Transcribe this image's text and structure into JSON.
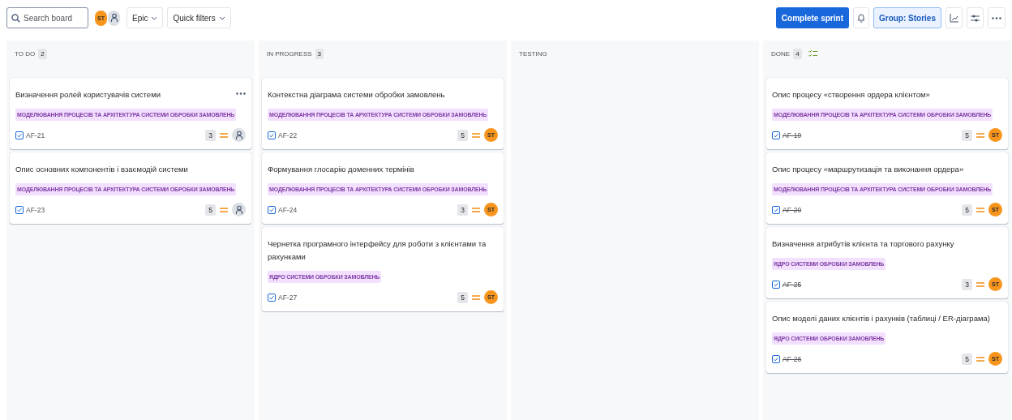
{
  "toolbar": {
    "search": {
      "placeholder": "Search board"
    },
    "avatars": [
      {
        "kind": "initials",
        "initials": "ST"
      },
      {
        "kind": "unassigned"
      }
    ],
    "filters": [
      {
        "label": "Epic"
      },
      {
        "label": "Quick filters"
      }
    ],
    "primary_button": "Complete sprint",
    "group_button": {
      "label": "Group: Stories",
      "selected": true
    }
  },
  "columns": [
    {
      "title": "TO DO",
      "count": "2",
      "done_icon": false,
      "cards": [
        {
          "title": "Визначення ролей користувачів системи",
          "epic": "МОДЕЛЮВАННЯ ПРОЦЕСІВ ТА АРХІТЕКТУРА СИСТЕМИ ОБРОБКИ ЗАМОВЛЕНЬ",
          "key": "AF-21",
          "done": false,
          "points": "3",
          "menu_shown": true,
          "assignee": {
            "kind": "unassigned"
          }
        },
        {
          "title": "Опис основних компонентів і взаємодій системи",
          "epic": "МОДЕЛЮВАННЯ ПРОЦЕСІВ ТА АРХІТЕКТУРА СИСТЕМИ ОБРОБКИ ЗАМОВЛЕНЬ",
          "key": "AF-23",
          "done": false,
          "points": "5",
          "menu_shown": false,
          "assignee": {
            "kind": "unassigned"
          }
        }
      ]
    },
    {
      "title": "IN PROGRESS",
      "count": "3",
      "done_icon": false,
      "cards": [
        {
          "title": "Контекстна діаграма системи обробки замовлень",
          "epic": "МОДЕЛЮВАННЯ ПРОЦЕСІВ ТА АРХІТЕКТУРА СИСТЕМИ ОБРОБКИ ЗАМОВЛЕНЬ",
          "key": "AF-22",
          "done": false,
          "points": "5",
          "menu_shown": false,
          "assignee": {
            "kind": "initials",
            "initials": "ST"
          }
        },
        {
          "title": "Формування глосарію доменних термінів",
          "epic": "МОДЕЛЮВАННЯ ПРОЦЕСІВ ТА АРХІТЕКТУРА СИСТЕМИ ОБРОБКИ ЗАМОВЛЕНЬ",
          "key": "AF-24",
          "done": false,
          "points": "3",
          "menu_shown": false,
          "assignee": {
            "kind": "initials",
            "initials": "ST"
          }
        },
        {
          "title": "Чернетка програмного інтерфейсу для роботи з клієнтами та рахунками",
          "epic": "ЯДРО СИСТЕМИ ОБРОБКИ ЗАМОВЛЕНЬ",
          "key": "AF-27",
          "done": false,
          "points": "5",
          "menu_shown": false,
          "assignee": {
            "kind": "initials",
            "initials": "ST"
          }
        }
      ]
    },
    {
      "title": "TESTING",
      "done_icon": false
    },
    {
      "title": "DONE",
      "count": "4",
      "done_icon": true,
      "cards": [
        {
          "title": "Опис процесу «створення ордера клієнтом»",
          "epic": "МОДЕЛЮВАННЯ ПРОЦЕСІВ ТА АРХІТЕКТУРА СИСТЕМИ ОБРОБКИ ЗАМОВЛЕНЬ",
          "key": "AF-19",
          "done": true,
          "points": "5",
          "menu_shown": false,
          "assignee": {
            "kind": "initials",
            "initials": "ST"
          }
        },
        {
          "title": "Опис процесу «маршрутизація та виконання ордера»",
          "epic": "МОДЕЛЮВАННЯ ПРОЦЕСІВ ТА АРХІТЕКТУРА СИСТЕМИ ОБРОБКИ ЗАМОВЛЕНЬ",
          "key": "AF-20",
          "done": true,
          "points": "5",
          "menu_shown": false,
          "assignee": {
            "kind": "initials",
            "initials": "ST"
          }
        },
        {
          "title": "Визначення атрибутів клієнта та торгового рахунку",
          "epic": "ЯДРО СИСТЕМИ ОБРОБКИ ЗАМОВЛЕНЬ",
          "key": "AF-25",
          "done": true,
          "points": "3",
          "menu_shown": false,
          "assignee": {
            "kind": "initials",
            "initials": "ST"
          }
        },
        {
          "title": "Опис моделі даних клієнтів і рахунків (таблиці / ER-діаграма)",
          "epic": "ЯДРО СИСТЕМИ ОБРОБКИ ЗАМОВЛЕНЬ",
          "key": "AF-26",
          "done": true,
          "points": "5",
          "menu_shown": false,
          "assignee": {
            "kind": "initials",
            "initials": "ST"
          }
        }
      ]
    }
  ]
}
